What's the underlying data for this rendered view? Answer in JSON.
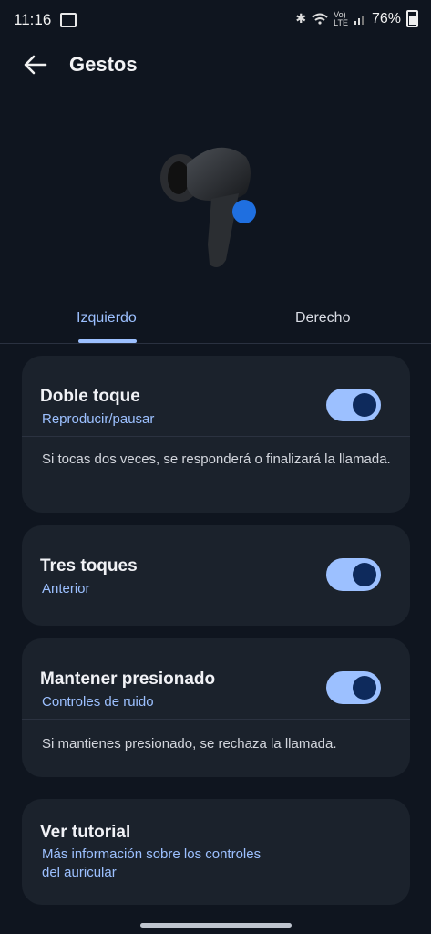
{
  "status_bar": {
    "time": "11:16",
    "battery": "76%",
    "icons": [
      "gallery-icon",
      "bluetooth-icon",
      "wifi-calling-icon",
      "volte-icon",
      "signal-icon",
      "battery-icon"
    ]
  },
  "header": {
    "title": "Gestos",
    "back_icon": "arrow-left-icon"
  },
  "tabs": [
    {
      "label": "Izquierdo",
      "selected": true
    },
    {
      "label": "Derecho",
      "selected": false
    }
  ],
  "cards": {
    "double_tap": {
      "title": "Doble toque",
      "subtitle": "Reproducir/pausar",
      "description": "Si tocas dos veces, se responderá o finalizará la llamada.",
      "enabled": true
    },
    "triple_tap": {
      "title": "Tres toques",
      "subtitle": "Anterior",
      "enabled": true
    },
    "press_hold": {
      "title": "Mantener presionado",
      "subtitle": "Controles de ruido",
      "description": "Si mantienes presionado, se rechaza la llamada.",
      "enabled": true
    },
    "tutorial": {
      "title": "Ver tutorial",
      "subtitle_line1": "Más información sobre los controles",
      "subtitle_line2": "del auricular"
    }
  },
  "colors": {
    "background": "#0f151f",
    "card": "#1b222c",
    "accent": "#9cc0ff",
    "toggle_knob": "#0e2a5c",
    "touch_point": "#1f6fe0"
  }
}
